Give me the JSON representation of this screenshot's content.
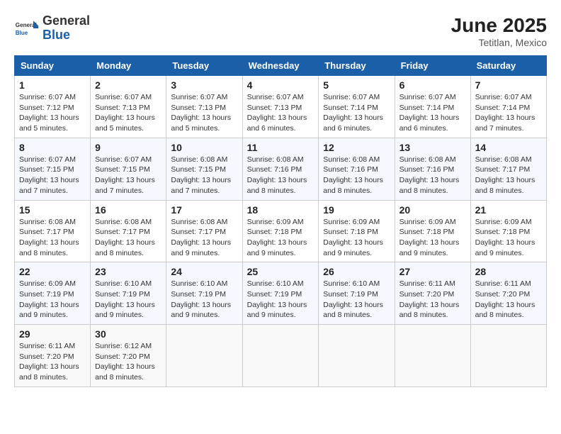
{
  "header": {
    "logo_general": "General",
    "logo_blue": "Blue",
    "month": "June 2025",
    "location": "Tetitlan, Mexico"
  },
  "days_of_week": [
    "Sunday",
    "Monday",
    "Tuesday",
    "Wednesday",
    "Thursday",
    "Friday",
    "Saturday"
  ],
  "weeks": [
    [
      {
        "day": "1",
        "info": "Sunrise: 6:07 AM\nSunset: 7:12 PM\nDaylight: 13 hours\nand 5 minutes."
      },
      {
        "day": "2",
        "info": "Sunrise: 6:07 AM\nSunset: 7:13 PM\nDaylight: 13 hours\nand 5 minutes."
      },
      {
        "day": "3",
        "info": "Sunrise: 6:07 AM\nSunset: 7:13 PM\nDaylight: 13 hours\nand 5 minutes."
      },
      {
        "day": "4",
        "info": "Sunrise: 6:07 AM\nSunset: 7:13 PM\nDaylight: 13 hours\nand 6 minutes."
      },
      {
        "day": "5",
        "info": "Sunrise: 6:07 AM\nSunset: 7:14 PM\nDaylight: 13 hours\nand 6 minutes."
      },
      {
        "day": "6",
        "info": "Sunrise: 6:07 AM\nSunset: 7:14 PM\nDaylight: 13 hours\nand 6 minutes."
      },
      {
        "day": "7",
        "info": "Sunrise: 6:07 AM\nSunset: 7:14 PM\nDaylight: 13 hours\nand 7 minutes."
      }
    ],
    [
      {
        "day": "8",
        "info": "Sunrise: 6:07 AM\nSunset: 7:15 PM\nDaylight: 13 hours\nand 7 minutes."
      },
      {
        "day": "9",
        "info": "Sunrise: 6:07 AM\nSunset: 7:15 PM\nDaylight: 13 hours\nand 7 minutes."
      },
      {
        "day": "10",
        "info": "Sunrise: 6:08 AM\nSunset: 7:15 PM\nDaylight: 13 hours\nand 7 minutes."
      },
      {
        "day": "11",
        "info": "Sunrise: 6:08 AM\nSunset: 7:16 PM\nDaylight: 13 hours\nand 8 minutes."
      },
      {
        "day": "12",
        "info": "Sunrise: 6:08 AM\nSunset: 7:16 PM\nDaylight: 13 hours\nand 8 minutes."
      },
      {
        "day": "13",
        "info": "Sunrise: 6:08 AM\nSunset: 7:16 PM\nDaylight: 13 hours\nand 8 minutes."
      },
      {
        "day": "14",
        "info": "Sunrise: 6:08 AM\nSunset: 7:17 PM\nDaylight: 13 hours\nand 8 minutes."
      }
    ],
    [
      {
        "day": "15",
        "info": "Sunrise: 6:08 AM\nSunset: 7:17 PM\nDaylight: 13 hours\nand 8 minutes."
      },
      {
        "day": "16",
        "info": "Sunrise: 6:08 AM\nSunset: 7:17 PM\nDaylight: 13 hours\nand 8 minutes."
      },
      {
        "day": "17",
        "info": "Sunrise: 6:08 AM\nSunset: 7:17 PM\nDaylight: 13 hours\nand 9 minutes."
      },
      {
        "day": "18",
        "info": "Sunrise: 6:09 AM\nSunset: 7:18 PM\nDaylight: 13 hours\nand 9 minutes."
      },
      {
        "day": "19",
        "info": "Sunrise: 6:09 AM\nSunset: 7:18 PM\nDaylight: 13 hours\nand 9 minutes."
      },
      {
        "day": "20",
        "info": "Sunrise: 6:09 AM\nSunset: 7:18 PM\nDaylight: 13 hours\nand 9 minutes."
      },
      {
        "day": "21",
        "info": "Sunrise: 6:09 AM\nSunset: 7:18 PM\nDaylight: 13 hours\nand 9 minutes."
      }
    ],
    [
      {
        "day": "22",
        "info": "Sunrise: 6:09 AM\nSunset: 7:19 PM\nDaylight: 13 hours\nand 9 minutes."
      },
      {
        "day": "23",
        "info": "Sunrise: 6:10 AM\nSunset: 7:19 PM\nDaylight: 13 hours\nand 9 minutes."
      },
      {
        "day": "24",
        "info": "Sunrise: 6:10 AM\nSunset: 7:19 PM\nDaylight: 13 hours\nand 9 minutes."
      },
      {
        "day": "25",
        "info": "Sunrise: 6:10 AM\nSunset: 7:19 PM\nDaylight: 13 hours\nand 9 minutes."
      },
      {
        "day": "26",
        "info": "Sunrise: 6:10 AM\nSunset: 7:19 PM\nDaylight: 13 hours\nand 8 minutes."
      },
      {
        "day": "27",
        "info": "Sunrise: 6:11 AM\nSunset: 7:20 PM\nDaylight: 13 hours\nand 8 minutes."
      },
      {
        "day": "28",
        "info": "Sunrise: 6:11 AM\nSunset: 7:20 PM\nDaylight: 13 hours\nand 8 minutes."
      }
    ],
    [
      {
        "day": "29",
        "info": "Sunrise: 6:11 AM\nSunset: 7:20 PM\nDaylight: 13 hours\nand 8 minutes."
      },
      {
        "day": "30",
        "info": "Sunrise: 6:12 AM\nSunset: 7:20 PM\nDaylight: 13 hours\nand 8 minutes."
      },
      {
        "day": "",
        "info": ""
      },
      {
        "day": "",
        "info": ""
      },
      {
        "day": "",
        "info": ""
      },
      {
        "day": "",
        "info": ""
      },
      {
        "day": "",
        "info": ""
      }
    ]
  ]
}
